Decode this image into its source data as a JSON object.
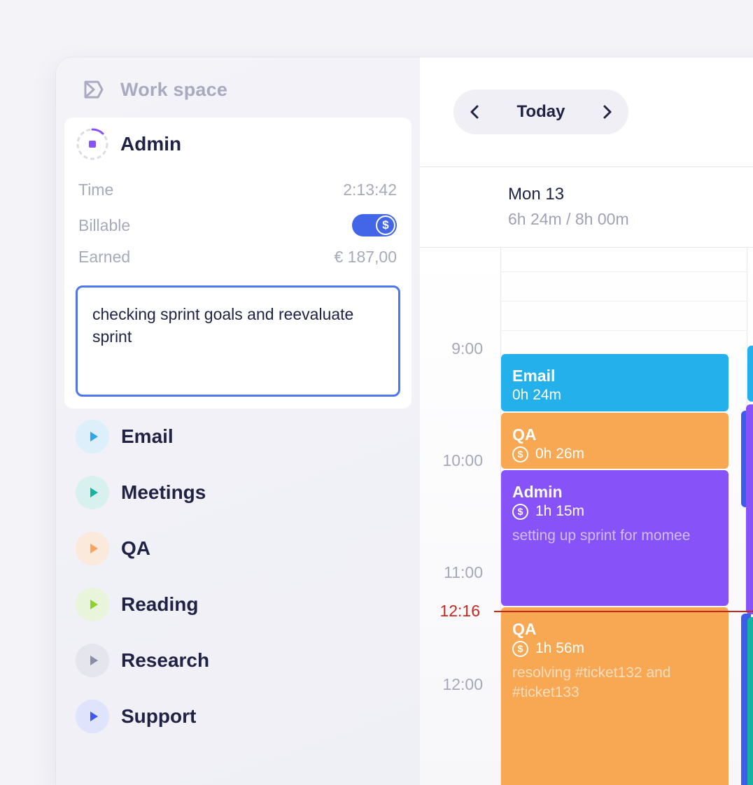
{
  "workspace": {
    "title": "Work space",
    "icon": "workspace-logo-icon"
  },
  "active": {
    "name": "Admin",
    "time_label": "Time",
    "time_value": "2:13:42",
    "billable_label": "Billable",
    "billable_on": true,
    "billable_symbol": "$",
    "earned_label": "Earned",
    "earned_value": "€ 187,00",
    "note": "checking sprint goals and reevaluate sprint"
  },
  "projects": [
    {
      "label": "Email",
      "color": "#2ba8e6",
      "bg": "#ddeffa"
    },
    {
      "label": "Meetings",
      "color": "#16b3a3",
      "bg": "#d9f1ee"
    },
    {
      "label": "QA",
      "color": "#f6a65a",
      "bg": "#fbe9db"
    },
    {
      "label": "Reading",
      "color": "#8fd22e",
      "bg": "#e8f5da"
    },
    {
      "label": "Research",
      "color": "#8b8ea6",
      "bg": "#e5e5ed"
    },
    {
      "label": "Support",
      "color": "#3d5cec",
      "bg": "#dfe3fb"
    }
  ],
  "calendar": {
    "today_label": "Today",
    "day_name": "Mon 13",
    "day_total": "6h 24m / 8h 00m",
    "hours": [
      "9:00",
      "10:00",
      "11:00",
      "12:00"
    ],
    "now_label": "12:16",
    "events": [
      {
        "title": "Email",
        "duration": "0h 24m",
        "billable": false,
        "note": "",
        "color": "#24b0ea"
      },
      {
        "title": "QA",
        "duration": "0h 26m",
        "billable": true,
        "note": "",
        "color": "#f8a752"
      },
      {
        "title": "Admin",
        "duration": "1h 15m",
        "billable": true,
        "note": "setting up sprint for momee",
        "color": "#8752f7"
      },
      {
        "title": "QA",
        "duration": "1h 56m",
        "billable": true,
        "note": "resolving #ticket132 and #ticket133",
        "color": "#f8a752"
      }
    ]
  }
}
